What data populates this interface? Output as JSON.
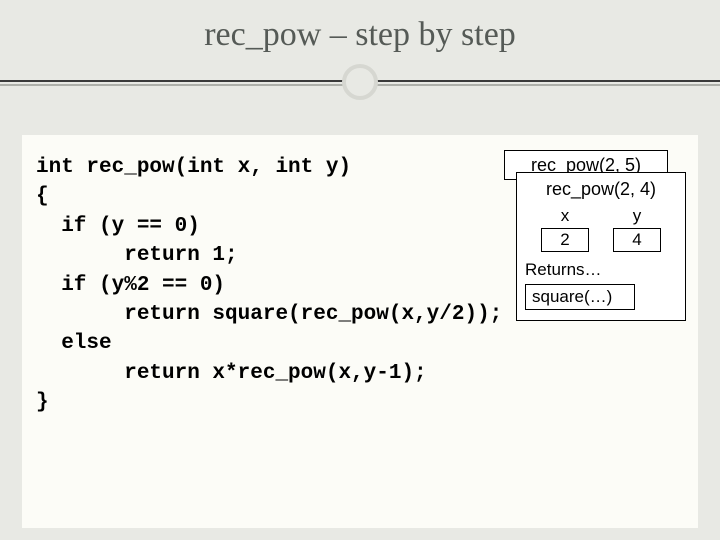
{
  "title": "rec_pow – step by step",
  "code": "int rec_pow(int x, int y)\n{\n  if (y == 0)\n       return 1;\n  if (y%2 == 0)\n       return square(rec_pow(x,y/2));\n  else\n       return x*rec_pow(x,y-1);\n}",
  "stack": {
    "back_frame_label": "rec_pow(2, 5)",
    "front_frame_label": "rec_pow(2, 4)",
    "x_label": "x",
    "y_label": "y",
    "x_value": "2",
    "y_value": "4",
    "returns_label": "Returns…",
    "returns_value": "square(…)"
  }
}
